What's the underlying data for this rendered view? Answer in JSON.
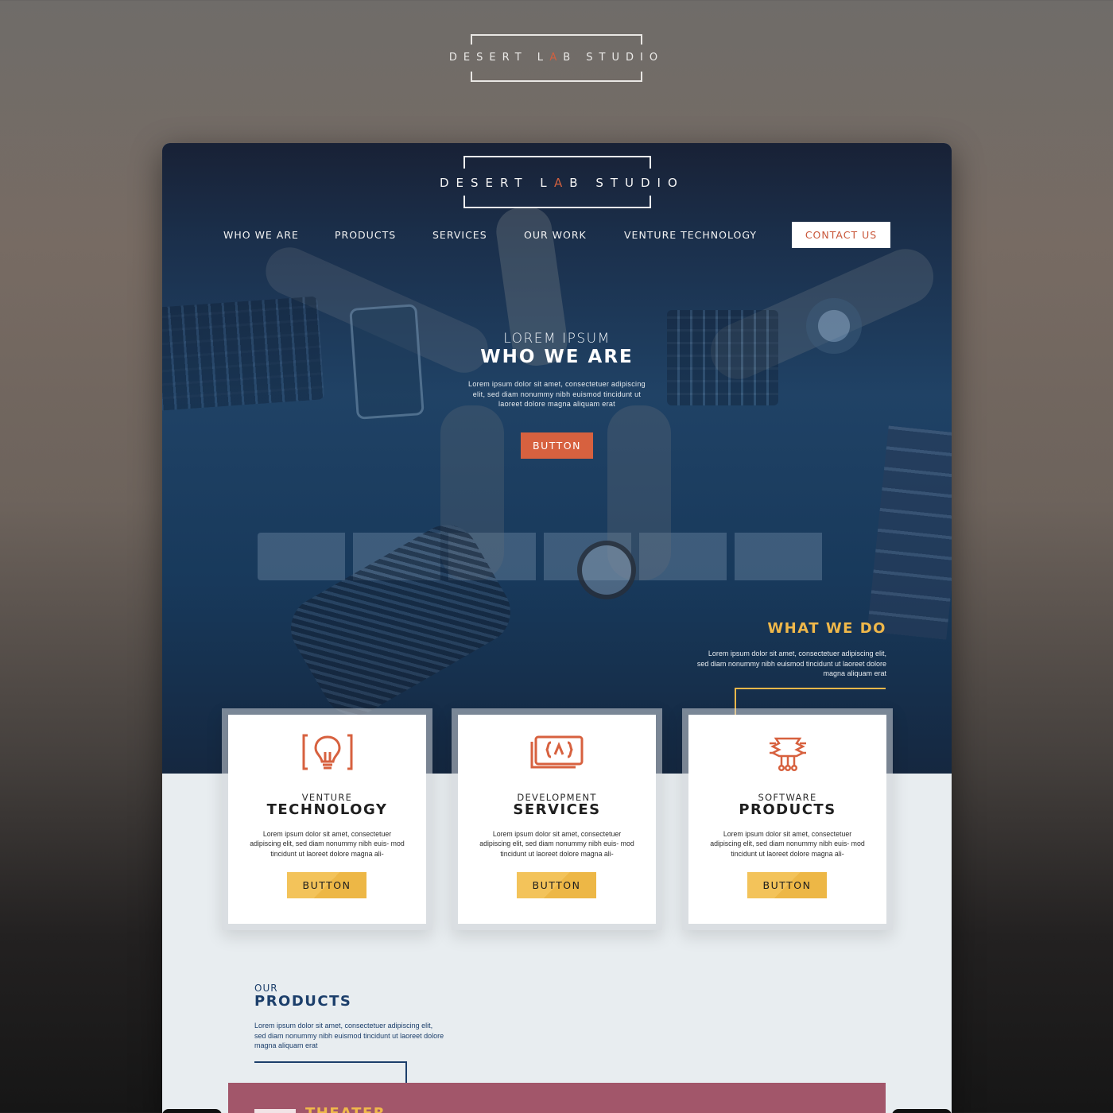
{
  "brand": {
    "logo_before": "DESERT L",
    "logo_accent": "A",
    "logo_after": "B STUDIO"
  },
  "nav": {
    "items": [
      "WHO WE ARE",
      "PRODUCTS",
      "SERVICES",
      "OUR WORK",
      "VENTURE TECHNOLOGY"
    ],
    "contact_label": "CONTACT US"
  },
  "hero": {
    "subtitle": "LOREM IPSUM",
    "title": "WHO WE ARE",
    "body": "Lorem ipsum dolor sit amet, consectetuer adipiscing elit, sed diam nonummy nibh euismod tincidunt ut laoreet dolore magna aliquam erat",
    "button_label": "BUTTON"
  },
  "what_we_do": {
    "title": "WHAT WE DO",
    "body": "Lorem ipsum dolor sit amet, consectetuer adipiscing elit, sed diam nonummy nibh euismod tincidunt ut laoreet dolore magna aliquam erat"
  },
  "cards": [
    {
      "icon": "lightbulb-icon",
      "small": "VENTURE",
      "big": "TECHNOLOGY",
      "body": "Lorem ipsum dolor sit amet, consectetuer adipiscing elit, sed diam nonummy nibh euis- mod tincidunt ut laoreet dolore magna ali-",
      "button_label": "BUTTON"
    },
    {
      "icon": "code-window-icon",
      "small": "DEVELOPMENT",
      "big": "SERVICES",
      "body": "Lorem ipsum dolor sit amet, consectetuer adipiscing elit, sed diam nonummy nibh euis- mod tincidunt ut laoreet dolore magna ali-",
      "button_label": "BUTTON"
    },
    {
      "icon": "circuit-chip-icon",
      "small": "SOFTWARE",
      "big": "PRODUCTS",
      "body": "Lorem ipsum dolor sit amet, consectetuer adipiscing elit, sed diam nonummy nibh euis- mod tincidunt ut laoreet dolore magna ali-",
      "button_label": "BUTTON"
    }
  ],
  "products": {
    "small": "OUR",
    "title": "PRODUCTS",
    "body": "Lorem ipsum dolor sit amet, consectetuer adipiscing elit, sed diam nonummy nibh euismod tincidunt ut laoreet dolore magna aliquam erat",
    "first_product_label": "THEATER"
  },
  "colors": {
    "accent_orange": "#d7613f",
    "accent_yellow": "#f0b84a",
    "navy": "#1c3f6b",
    "product_card": "#a2566a"
  }
}
